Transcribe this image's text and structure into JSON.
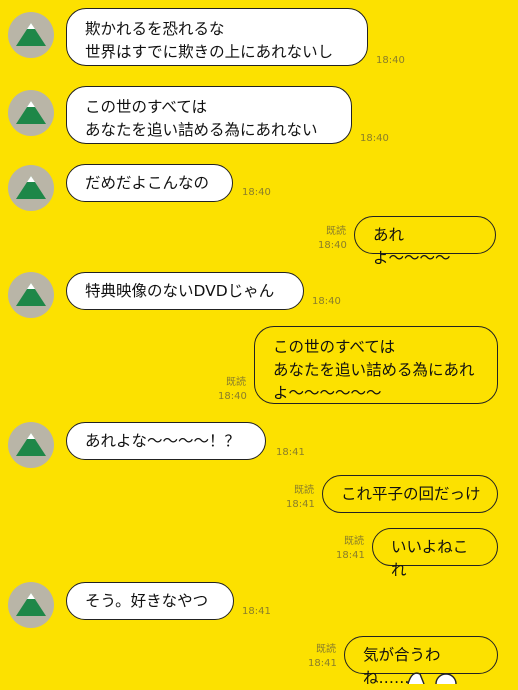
{
  "colors": {
    "background": "#FCE100",
    "bubble_other": "#FFFFFF",
    "bubble_self": "#FCE100",
    "meta_text": "#8A7E2A"
  },
  "read_label": "既読",
  "messages": [
    {
      "sender": "other",
      "text": "欺かれるを恐れるな\n世界はすでに欺きの上にあれないし",
      "time": "18:40"
    },
    {
      "sender": "other",
      "text": "この世のすべては\nあなたを追い詰める為にあれない",
      "time": "18:40"
    },
    {
      "sender": "other",
      "text": "だめだよこんなの",
      "time": "18:40"
    },
    {
      "sender": "self",
      "text": "あれよ〜〜〜〜",
      "time": "18:40",
      "read": "既読"
    },
    {
      "sender": "other",
      "text": "特典映像のないDVDじゃん",
      "time": "18:40"
    },
    {
      "sender": "self",
      "text": "この世のすべては\nあなたを追い詰める為にあれ\nよ〜〜〜〜〜〜",
      "time": "18:40",
      "read": "既読"
    },
    {
      "sender": "other",
      "text": "あれよな〜〜〜〜！？",
      "time": "18:41"
    },
    {
      "sender": "self",
      "text": "これ平子の回だっけ",
      "time": "18:41",
      "read": "既読"
    },
    {
      "sender": "self",
      "text": "いいよねこれ",
      "time": "18:41",
      "read": "既読"
    },
    {
      "sender": "other",
      "text": "そう。好きなやつ",
      "time": "18:41"
    },
    {
      "sender": "self",
      "text": "気が合うわね……",
      "time": "18:41",
      "read": "既読"
    }
  ]
}
